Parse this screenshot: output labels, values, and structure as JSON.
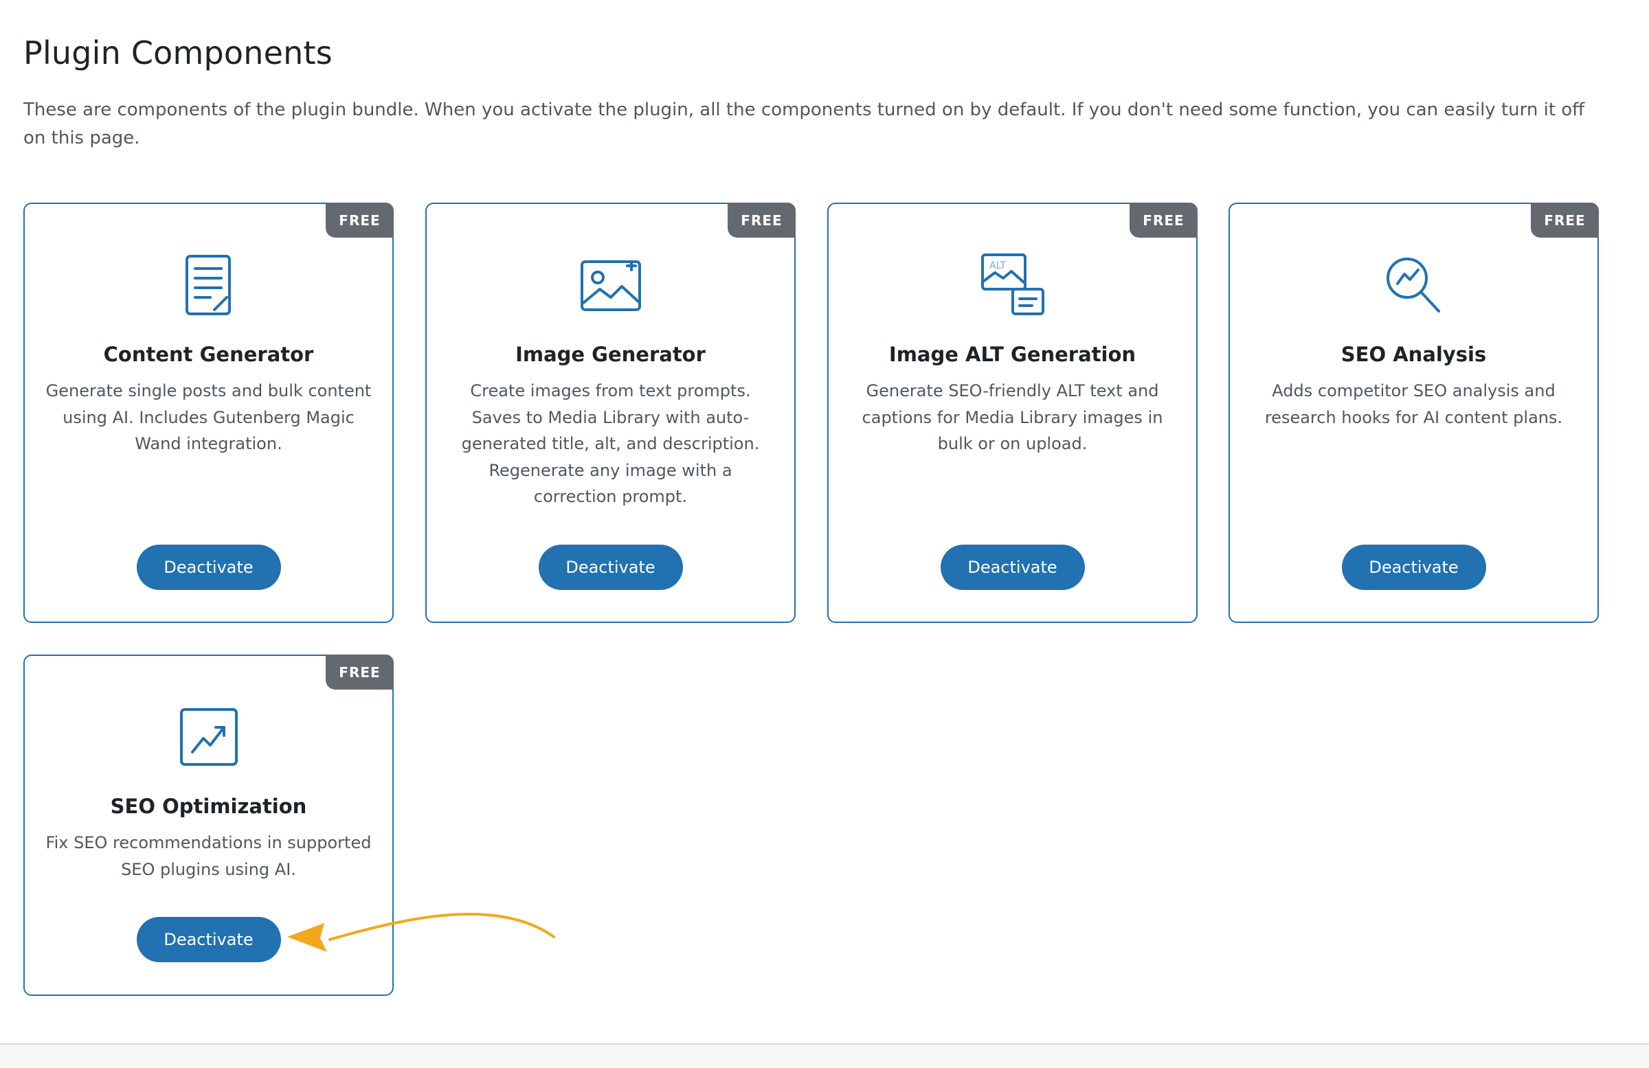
{
  "page": {
    "title": "Plugin Components",
    "description": "These are components of the plugin bundle. When you activate the plugin, all the components turned on by default. If you don't need some function, you can easily turn it off on this page."
  },
  "colors": {
    "accent": "#2271b1",
    "badge": "#646970",
    "arrow": "#f2a81d"
  },
  "components": [
    {
      "badge": "FREE",
      "icon": "document-edit-icon",
      "title": "Content Generator",
      "description": "Generate single posts and bulk content using AI. Includes Gutenberg Magic Wand integration.",
      "button": "Deactivate"
    },
    {
      "badge": "FREE",
      "icon": "image-sparkle-icon",
      "title": "Image Generator",
      "description": "Create images from text prompts. Saves to Media Library with auto-generated title, alt, and description. Regenerate any image with a correction prompt.",
      "button": "Deactivate"
    },
    {
      "badge": "FREE",
      "icon": "image-alt-text-icon",
      "title": "Image ALT Generation",
      "description": "Generate SEO-friendly ALT text and captions for Media Library images in bulk or on upload.",
      "button": "Deactivate"
    },
    {
      "badge": "FREE",
      "icon": "magnifier-chart-icon",
      "title": "SEO Analysis",
      "description": "Adds competitor SEO analysis and research hooks for AI content plans.",
      "button": "Deactivate"
    },
    {
      "badge": "FREE",
      "icon": "trend-chart-icon",
      "title": "SEO Optimization",
      "description": "Fix SEO recommendations in supported SEO plugins using AI.",
      "button": "Deactivate"
    }
  ]
}
